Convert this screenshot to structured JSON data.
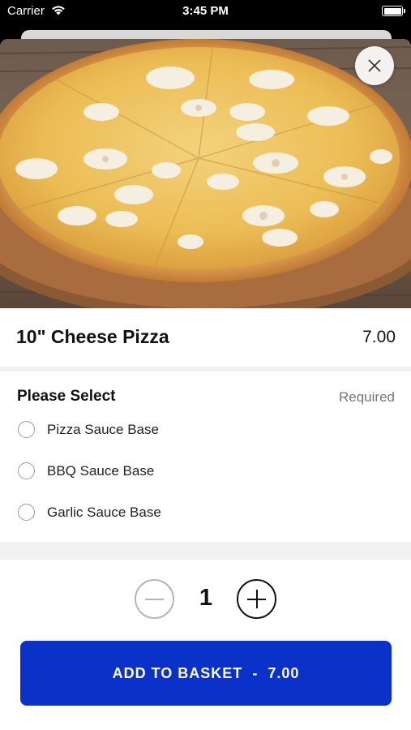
{
  "status_bar": {
    "carrier": "Carrier",
    "time": "3:45 PM"
  },
  "product": {
    "image_icon": "cheese-pizza-photo",
    "name": "10\" Cheese Pizza",
    "price": "7.00"
  },
  "options": {
    "title": "Please Select",
    "required_label": "Required",
    "items": [
      {
        "label": "Pizza Sauce Base",
        "selected": false
      },
      {
        "label": "BBQ Sauce Base",
        "selected": false
      },
      {
        "label": "Garlic Sauce Base",
        "selected": false
      }
    ]
  },
  "quantity": {
    "value": "1"
  },
  "add_to_basket": {
    "label": "ADD TO BASKET",
    "separator": "-",
    "price": "7.00",
    "color": "#0a32c8"
  }
}
